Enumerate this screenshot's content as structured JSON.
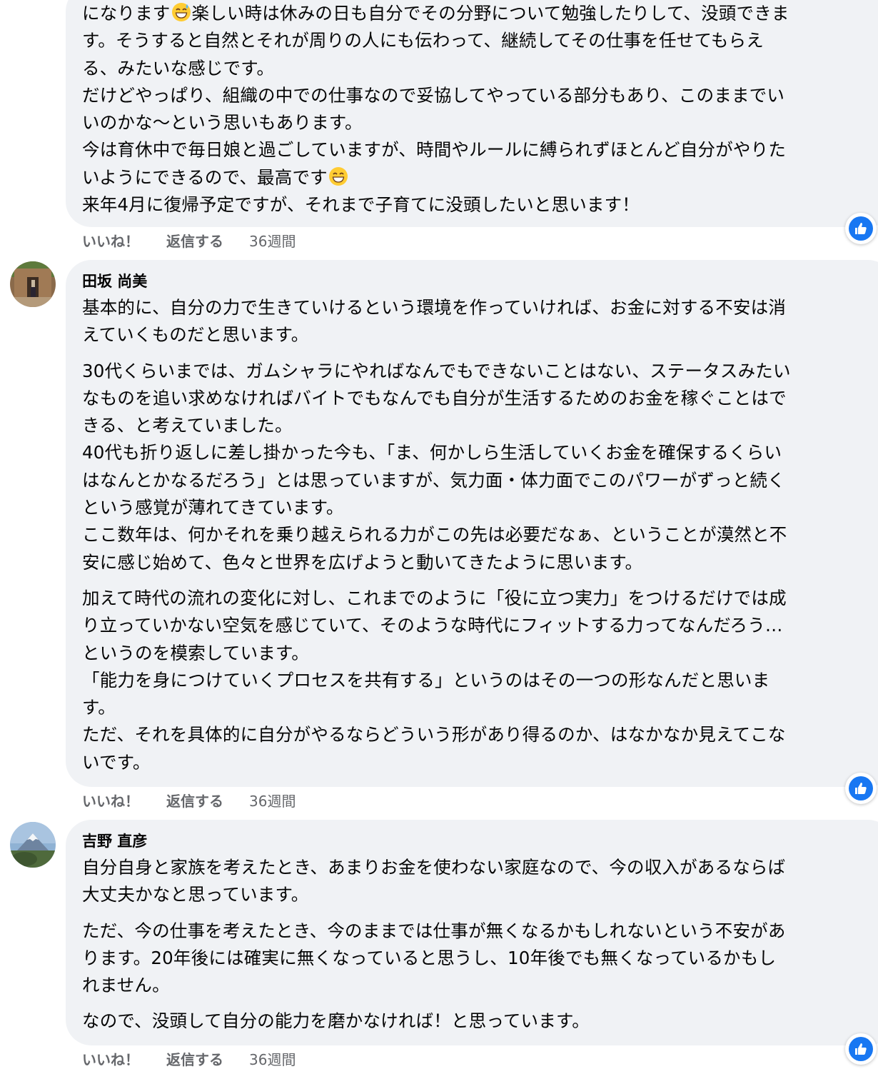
{
  "comments": [
    {
      "author": "",
      "lines": [
        [
          "になります",
          "{emoji:sweat-smile}",
          "楽しい時は休みの日も自分でその分野について勉強したりして、没頭できま"
        ],
        [
          "す。そうすると自然とそれが周りの人にも伝わって、継続してその仕事を任せてもらえ"
        ],
        [
          "る、みたいな感じです。"
        ],
        [
          "だけどやっぱり、組織の中での仕事なので妥協してやっている部分もあり、このままでい"
        ],
        [
          "いのかな〜という思いもあります。"
        ],
        [
          "今は育休中で毎日娘と過ごしていますが、時間やルールに縛られずほとんど自分がやりた"
        ],
        [
          "いようにできるので、最高です",
          "{emoji:grin}"
        ],
        [
          "来年4月に復帰予定ですが、それまで子育てに没頭したいと思います！"
        ]
      ],
      "actions": {
        "like": "いいね！",
        "reply": "返信する",
        "time": "36週間"
      }
    },
    {
      "author": "田坂 尚美",
      "paragraphs": [
        [
          "基本的に、自分の力で生きていけるという環境を作っていければ、お金に対する不安は消",
          "えていくものだと思います。"
        ],
        [
          "30代くらいまでは、ガムシャラにやればなんでもできないことはない、ステータスみたい",
          "なものを追い求めなければバイトでもなんでも自分が生活するためのお金を稼ぐことはで",
          "きる、と考えていました。",
          "40代も折り返しに差し掛かった今も、「ま、何かしら生活していくお金を確保するくらい",
          "はなんとかなるだろう」とは思っていますが、気力面・体力面でこのパワーがずっと続く",
          "という感覚が薄れてきています。",
          "ここ数年は、何かそれを乗り越えられる力がこの先は必要だなぁ、ということが漠然と不",
          "安に感じ始めて、色々と世界を広げようと動いてきたように思います。"
        ],
        [
          "加えて時代の流れの変化に対し、これまでのように「役に立つ実力」をつけるだけでは成",
          "り立っていかない空気を感じていて、そのような時代にフィットする力ってなんだろう…",
          "というのを模索しています。",
          "「能力を身につけていくプロセスを共有する」というのはその一つの形なんだと思いま",
          "す。",
          "ただ、それを具体的に自分がやるならどういう形があり得るのか、はなかなか見えてこな",
          "いです。"
        ]
      ],
      "actions": {
        "like": "いいね！",
        "reply": "返信する",
        "time": "36週間"
      }
    },
    {
      "author": "吉野 直彦",
      "paragraphs": [
        [
          "自分自身と家族を考えたとき、あまりお金を使わない家庭なので、今の収入があるならば",
          "大丈夫かなと思っています。"
        ],
        [
          "ただ、今の仕事を考えたとき、今のままでは仕事が無くなるかもしれないという不安があ",
          "ります。20年後には確実に無くなっていると思うし、10年後でも無くなっているかもし",
          "れません。"
        ],
        [
          "なので、没頭して自分の能力を磨かなければ！と思っています。"
        ]
      ],
      "actions": {
        "like": "いいね！",
        "reply": "返信する",
        "time": "36週間"
      }
    }
  ],
  "icons": {
    "reaction": "like-thumbs-up-icon",
    "emoji_1": "sweat-smile-emoji-icon",
    "emoji_2": "grinning-emoji-icon"
  },
  "colors": {
    "bubble": "#f0f2f5",
    "like_blue": "#1877f2",
    "meta_gray": "#65676b",
    "text": "#050505"
  }
}
